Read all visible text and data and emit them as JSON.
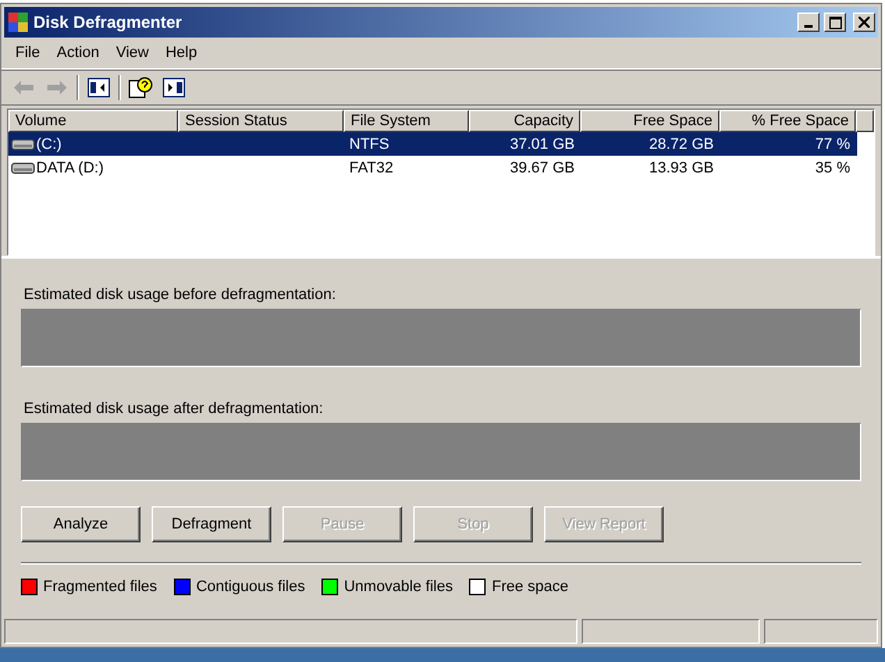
{
  "window": {
    "title": "Disk Defragmenter"
  },
  "menu": [
    "File",
    "Action",
    "View",
    "Help"
  ],
  "toolbar": [
    [
      {
        "kind": "back",
        "disabled": true
      },
      {
        "kind": "forward",
        "disabled": true
      }
    ],
    [
      {
        "kind": "pane",
        "disabled": false
      }
    ],
    [
      {
        "kind": "help",
        "disabled": false
      },
      {
        "kind": "pane2",
        "disabled": false
      }
    ]
  ],
  "table": {
    "columns": [
      {
        "label": "Volume",
        "kind": "text"
      },
      {
        "label": "Session Status",
        "kind": "text"
      },
      {
        "label": "File System",
        "kind": "text"
      },
      {
        "label": "Capacity",
        "kind": "number"
      },
      {
        "label": "Free Space",
        "kind": "number"
      },
      {
        "label": "% Free Space",
        "kind": "number"
      }
    ],
    "rows": [
      {
        "selected": true,
        "cells": [
          "(C:)",
          "",
          "NTFS",
          "37.01 GB",
          "28.72 GB",
          "77 %"
        ]
      },
      {
        "selected": false,
        "cells": [
          "DATA (D:)",
          "",
          "FAT32",
          "39.67 GB",
          "13.93 GB",
          "35 %"
        ]
      }
    ]
  },
  "usage": [
    {
      "label": "Estimated disk usage before defragmentation:"
    },
    {
      "label": "Estimated disk usage after defragmentation:"
    }
  ],
  "buttons": [
    {
      "label": "Analyze",
      "disabled": false
    },
    {
      "label": "Defragment",
      "disabled": false
    },
    {
      "label": "Pause",
      "disabled": true
    },
    {
      "label": "Stop",
      "disabled": true
    },
    {
      "label": "View Report",
      "disabled": true
    }
  ],
  "legend": [
    {
      "label": "Fragmented files",
      "color": "#ff0000"
    },
    {
      "label": "Contiguous files",
      "color": "#0000ff"
    },
    {
      "label": "Unmovable files",
      "color": "#00ff00"
    },
    {
      "label": "Free space",
      "color": "#ffffff"
    }
  ]
}
